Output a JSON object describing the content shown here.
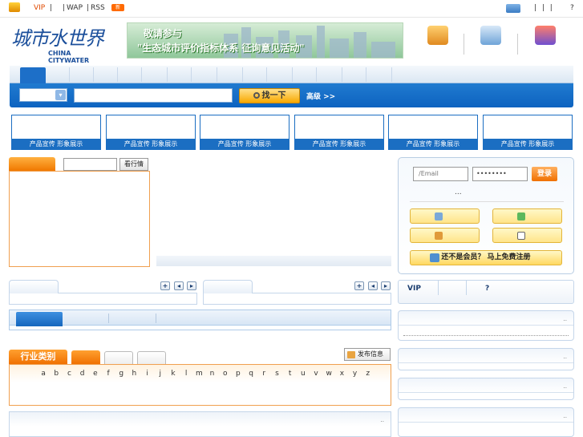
{
  "topbar": {
    "vip": "VIP",
    "sep1": "|",
    "sep2": "|",
    "wap": "WAP",
    "sep3": "|",
    "rss": "RSS",
    "new_badge": "新",
    "right_seps": "|     |     |",
    "help": "?"
  },
  "header": {
    "logo_text": "城市水世界",
    "logo_en": "CHINA CITYWATER",
    "banner_line1": "敬请参与",
    "banner_line2": "\"生态城市评价指标体系 征询意见活动\""
  },
  "search": {
    "button_label": "找一下",
    "advanced_label": "高级 >>"
  },
  "promos": {
    "caption": "产品宣传 形象展示"
  },
  "ranking": {
    "button_label": "看行情"
  },
  "login": {
    "email_placeholder": "/Email",
    "password_mask": "••••••••",
    "login_label": "登录",
    "dots": "...",
    "register_label": "还不是会员？ 马上免费注册"
  },
  "midpanels": {
    "plus": "+",
    "prev": "◂",
    "next": "▸"
  },
  "vip_panel": {
    "vip": "VIP",
    "help": "?"
  },
  "more": "..",
  "industry": {
    "title": "行业类别",
    "publish_label": "发布信息",
    "letters": [
      "a",
      "b",
      "c",
      "d",
      "e",
      "f",
      "g",
      "h",
      "i",
      "j",
      "k",
      "l",
      "m",
      "n",
      "o",
      "p",
      "q",
      "r",
      "s",
      "t",
      "u",
      "v",
      "w",
      "x",
      "y",
      "z"
    ]
  },
  "colors": {
    "primary_blue": "#1b6ec2",
    "accent_orange": "#f07800",
    "link_orange": "#e04a00"
  },
  "icons": [
    "shield-icon",
    "user-card-icon",
    "house-icon",
    "edit-icon",
    "package-icon",
    "search-icon",
    "dropdown-icon",
    "pencil-icon",
    "arrow-icon",
    "tool-icon",
    "mail-icon",
    "register-icon",
    "publish-icon"
  ]
}
